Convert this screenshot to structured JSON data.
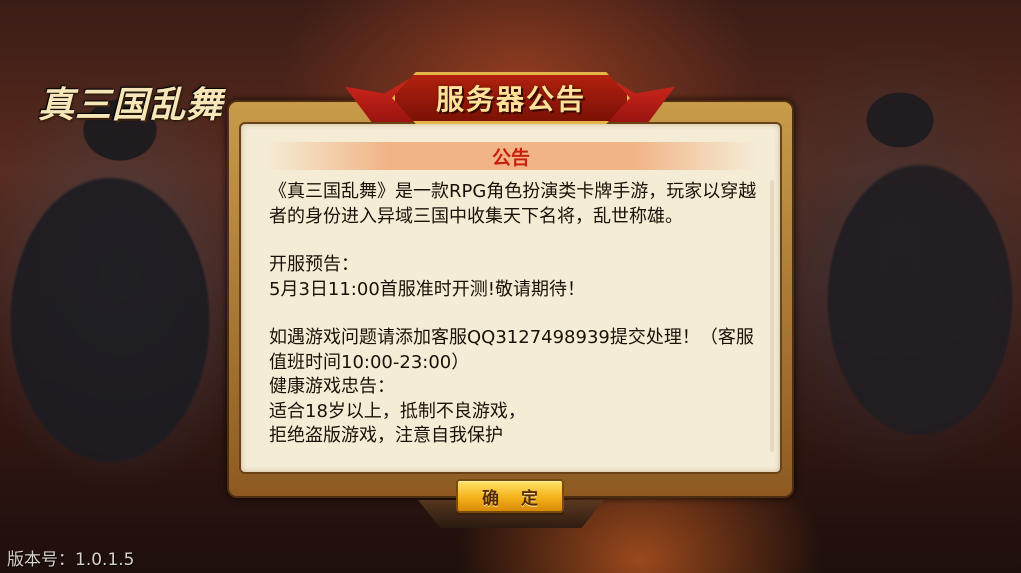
{
  "game": {
    "logo_text": "真三国乱舞"
  },
  "dialog": {
    "title": "服务器公告",
    "section_title": "公告",
    "paragraphs": [
      "《真三国乱舞》是一款RPG角色扮演类卡牌手游，玩家以穿越者的身份进入异域三国中收集天下名将，乱世称雄。",
      "",
      "开服预告：",
      "5月3日11:00首服准时开测!敬请期待！",
      "",
      "如遇游戏问题请添加客服QQ3127498939提交处理！（客服值班时间10:00-23:00）",
      "健康游戏忠告：",
      "适合18岁以上，抵制不良游戏，",
      "拒绝盗版游戏，注意自我保护"
    ],
    "confirm_label": "确 定"
  },
  "footer": {
    "version": "版本号：1.0.1.5"
  },
  "colors": {
    "title_text": "#ffe29a",
    "section_title": "#c8200c",
    "panel_bg": "#f5ecd6",
    "button_gold": "#f3b21a"
  }
}
